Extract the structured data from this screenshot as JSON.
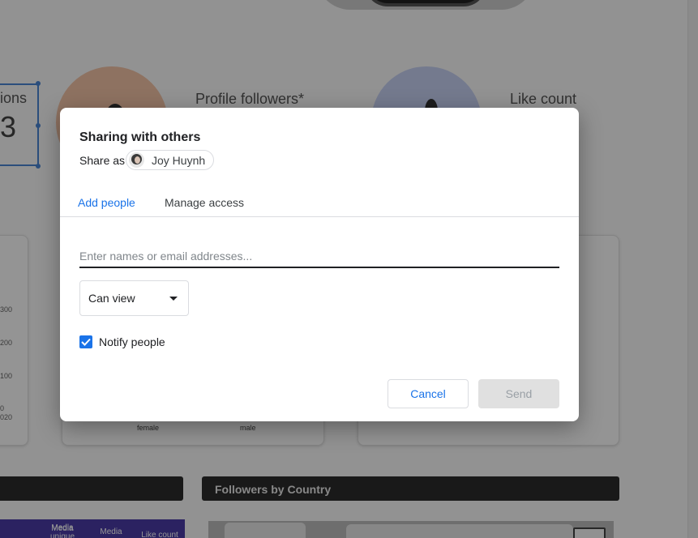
{
  "dialog": {
    "title": "Sharing with others",
    "share_as_label": "Share as",
    "share_as_user": "Joy Huynh",
    "tabs": [
      {
        "label": "Add people",
        "active": true
      },
      {
        "label": "Manage access",
        "active": false
      }
    ],
    "email_placeholder": "Enter names or email addresses...",
    "email_value": "",
    "permission": {
      "selected": "Can view"
    },
    "notify": {
      "label": "Notify people",
      "checked": true
    },
    "buttons": {
      "cancel": "Cancel",
      "send": "Send"
    }
  },
  "background": {
    "selected_metric_text": "ions",
    "selected_metric_value": "3",
    "stats": [
      {
        "label": "Profile followers*"
      },
      {
        "label": "Like count"
      }
    ],
    "axis_ticks": [
      "300",
      "200",
      "100",
      "0",
      "020"
    ],
    "gender_labels": [
      "female",
      "male"
    ],
    "sections": {
      "followers_by_country": "Followers by Country"
    },
    "table_headers": [
      "Media",
      "Media unique",
      "Media",
      "Like count"
    ]
  },
  "colors": {
    "accent": "#1a73e8",
    "scrim": "rgba(0,0,0,0.42)",
    "header_purple": "#4a3ca8",
    "dark_bar": "#2b2b2b"
  }
}
